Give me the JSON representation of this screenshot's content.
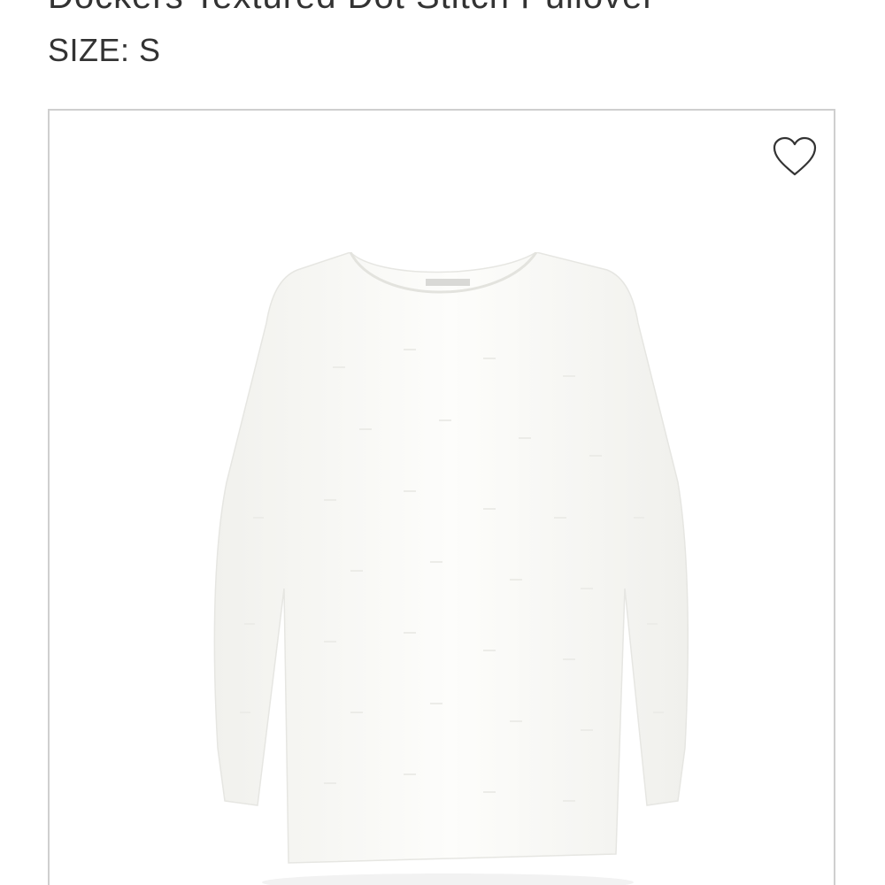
{
  "product": {
    "title": "Dockers Textured Dot Stitch Pullover",
    "size_label": "SIZE:",
    "size_value": "S"
  },
  "card": {
    "favorite_icon": "heart-outline-icon",
    "image_subject": "white-textured-sweater"
  },
  "colors": {
    "text": "#333333",
    "card_border": "#cfcfcf",
    "sweater": "#fbfbf8"
  }
}
